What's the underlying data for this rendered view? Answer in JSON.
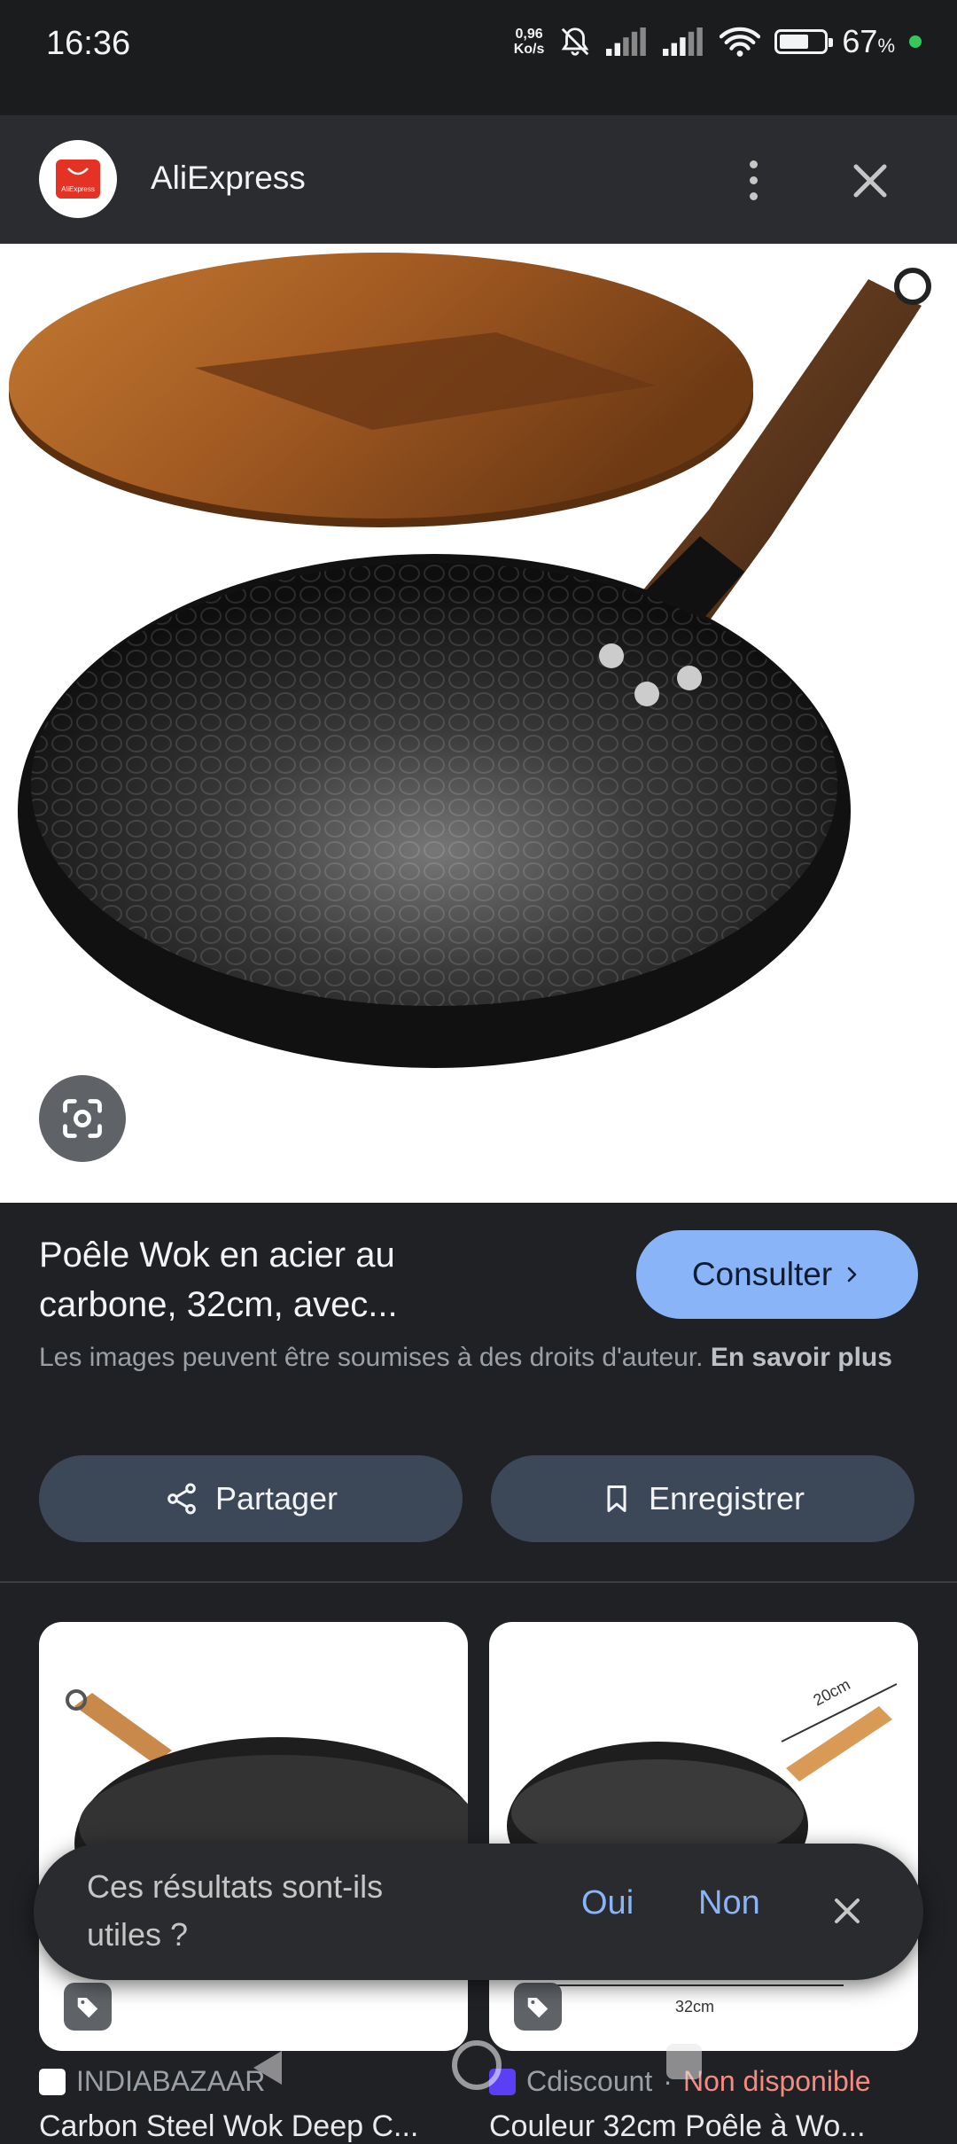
{
  "status_bar": {
    "time": "16:36",
    "net_speed_value": "0,96",
    "net_speed_unit": "Ko/s",
    "battery_percent": "67",
    "battery_symbol": "%",
    "battery_level": 0.67,
    "icons": [
      "bell-off-icon",
      "signal-icon",
      "signal-icon",
      "wifi-icon",
      "battery-icon",
      "charging-dot-icon"
    ]
  },
  "header": {
    "app_name": "AliExpress",
    "logo_text": "AliExpress",
    "icons": [
      "more-vert-icon",
      "close-icon"
    ]
  },
  "product": {
    "title_line1": "Poêle Wok en acier au",
    "title_line2": "carbone, 32cm, avec...",
    "visit_label": "Consulter",
    "copyright_text": "Les images peuvent être soumises à des droits d'auteur.",
    "learn_more": "En savoir plus",
    "share_label": "Partager",
    "save_label": "Enregistrer"
  },
  "results": [
    {
      "source": "INDIABAZAAR",
      "title": "Carbon Steel Wok Deep C...",
      "status": ""
    },
    {
      "source": "Cdiscount",
      "separator": "·",
      "status": "Non disponible",
      "title": "Couleur 32cm Poêle à Wo...",
      "image_label_size": "20cm",
      "image_label_width": "32cm"
    }
  ],
  "feedback": {
    "question": "Ces résultats sont-ils utiles ?",
    "yes": "Oui",
    "no": "Non"
  },
  "colors": {
    "accent": "#8ab4f8",
    "background": "#202124",
    "pill": "#3c4758",
    "unavailable": "#f28b82",
    "brand": "#e43225"
  }
}
